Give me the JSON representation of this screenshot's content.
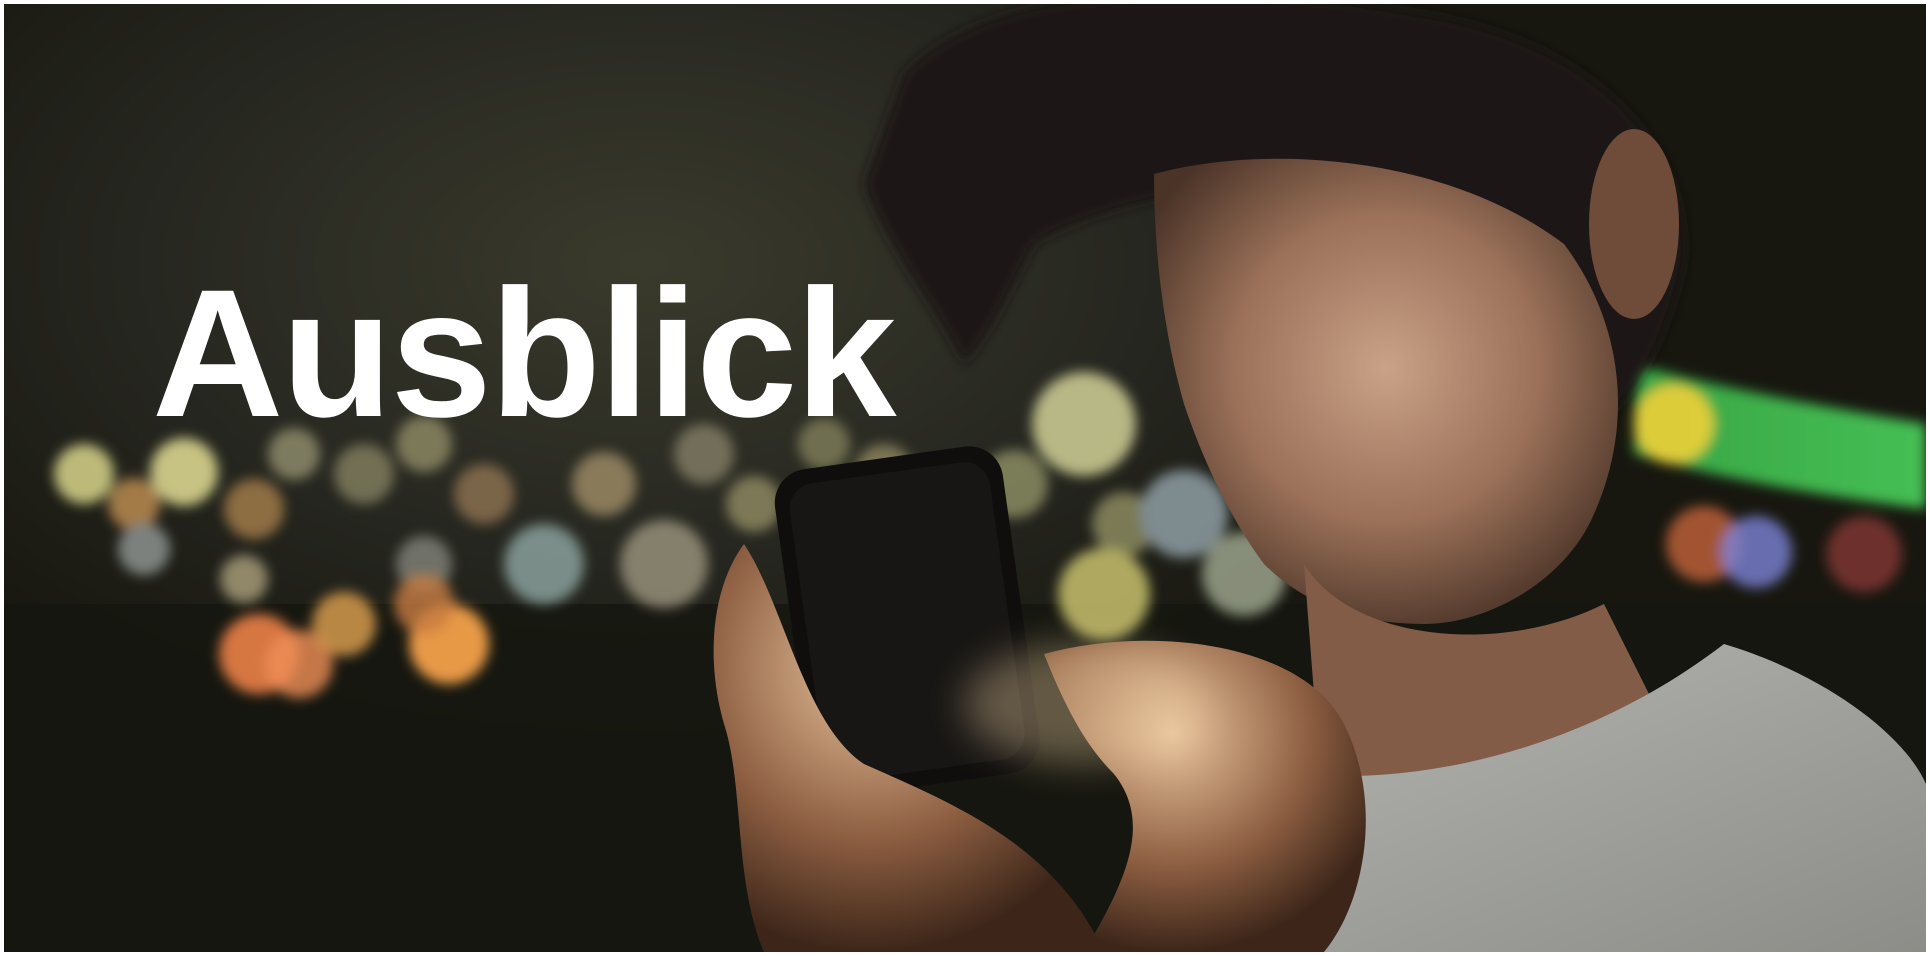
{
  "slide": {
    "title": "Ausblick",
    "title_color": "#ffffff",
    "background_color": "#23241c"
  }
}
